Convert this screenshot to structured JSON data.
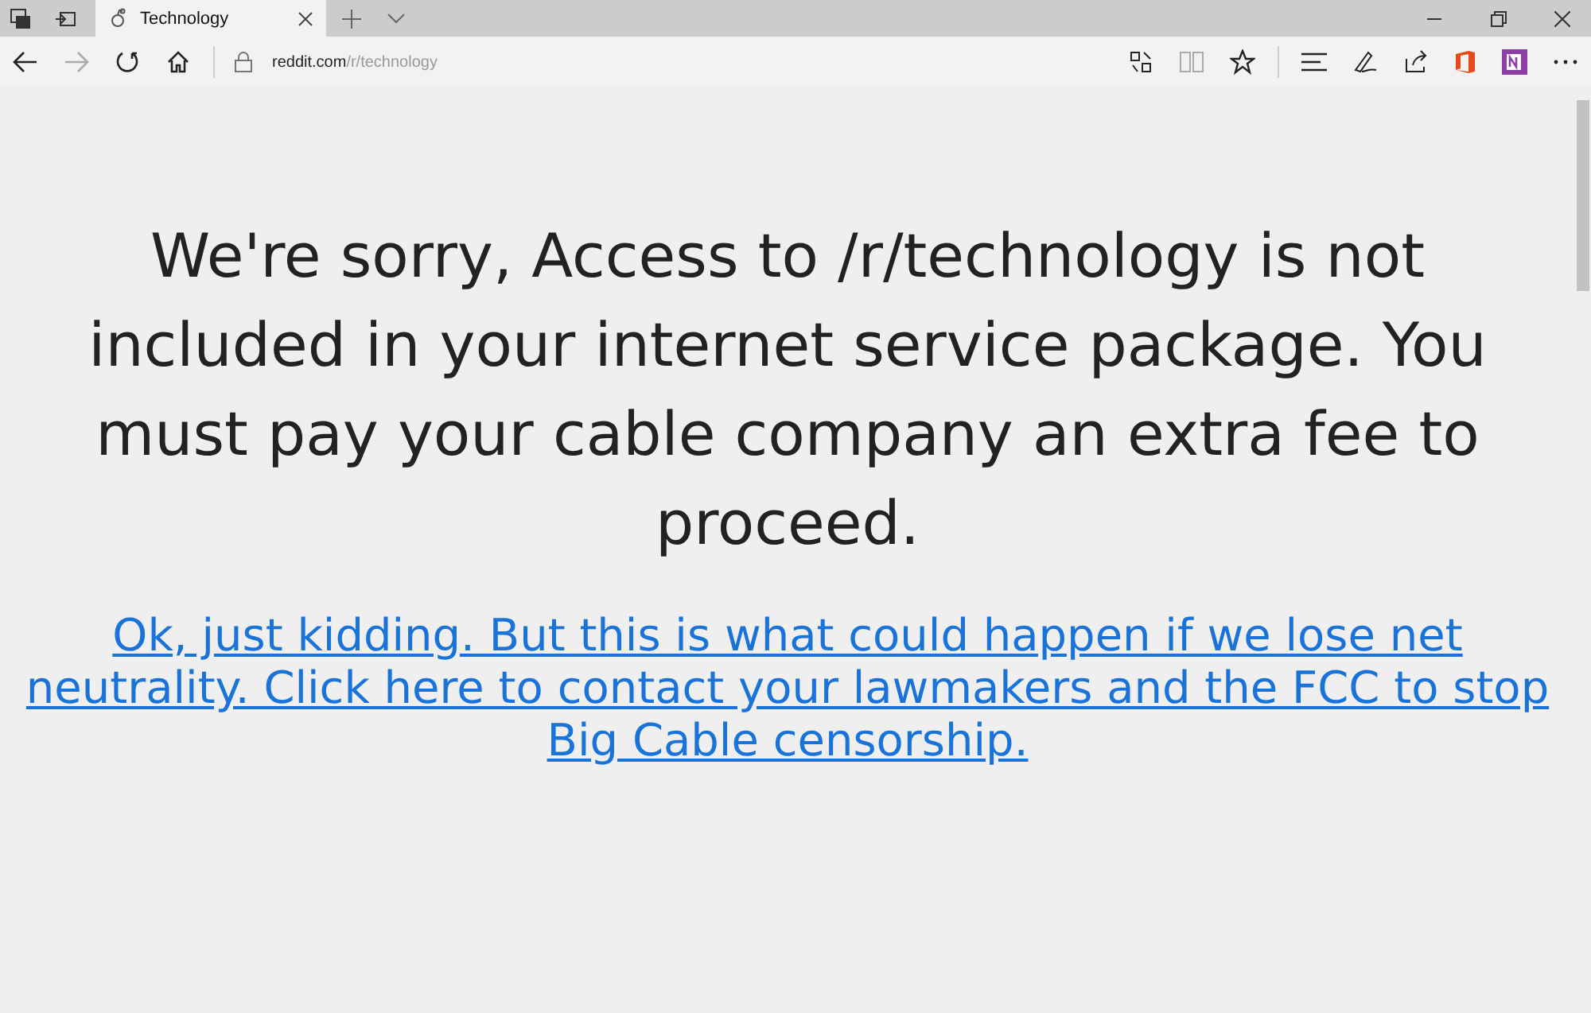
{
  "tabs": [
    {
      "title": "Technology",
      "selected": true
    }
  ],
  "address_bar": {
    "host": "reddit.com",
    "path": "/r/technology"
  },
  "page": {
    "heading": "We're sorry, Access to /r/technology is not included in your internet service package. You must pay your cable company an extra fee to proceed.",
    "link": "Ok, just kidding. But this is what could happen if we lose net neutrality. Click here to contact your lawmakers and the FCC to stop Big Cable censorship."
  }
}
